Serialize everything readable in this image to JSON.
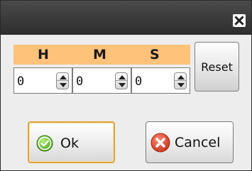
{
  "window": {
    "close_icon": "close-icon"
  },
  "header": {
    "h": "H",
    "m": "M",
    "s": "S",
    "color": "#ffc27a"
  },
  "spinners": {
    "hours": {
      "value": "0"
    },
    "minutes": {
      "value": "0"
    },
    "seconds": {
      "value": "0"
    }
  },
  "buttons": {
    "reset_label": "Reset",
    "ok_label": "Ok",
    "cancel_label": "Cancel",
    "ok_icon": "check-circle-icon",
    "cancel_icon": "x-circle-icon"
  }
}
